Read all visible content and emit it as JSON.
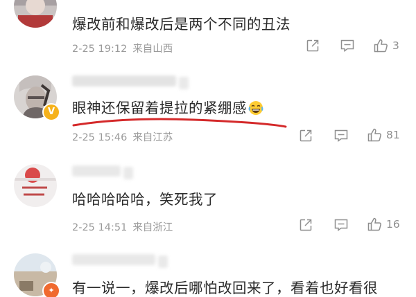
{
  "comments": [
    {
      "username": "",
      "text": "爆改前和爆改后是两个不同的丑法",
      "date": "2-25 19:12",
      "location": "来自山西",
      "likes": "3"
    },
    {
      "username": "",
      "text": "眼神还保留着提拉的紧绷感",
      "date": "2-25 15:46",
      "location": "来自江苏",
      "likes": "81",
      "emoji": "laughing-tears-emoji",
      "badge": "V"
    },
    {
      "username": "",
      "text": "哈哈哈哈哈，笑死我了",
      "date": "2-25 14:51",
      "location": "来自浙江",
      "likes": "16"
    },
    {
      "username": "",
      "text": "有一说一，爆改后哪怕改回来了，看着也好看很",
      "date": "",
      "location": "",
      "likes": ""
    }
  ],
  "icons": {
    "share": "share-icon",
    "comment": "comment-icon",
    "like": "thumbs-up-icon"
  },
  "colors": {
    "text": "#2b2b2b",
    "meta": "#9a9a9a",
    "underline": "#d4292a",
    "badge": "#f6b21b"
  }
}
